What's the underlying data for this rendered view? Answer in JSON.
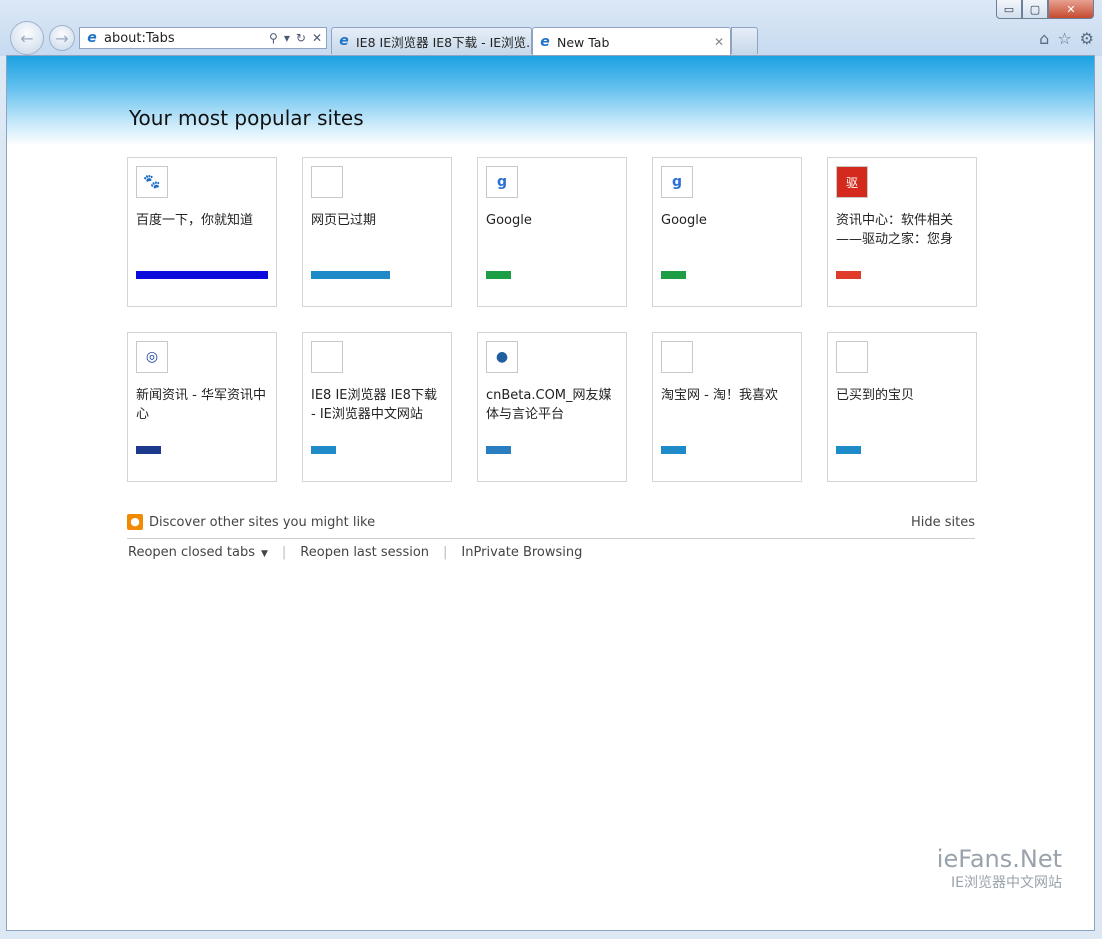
{
  "window": {
    "minimize_label": "▭",
    "maximize_label": "▢",
    "close_label": "✕"
  },
  "nav": {
    "back_icon": "←",
    "forward_icon": "→"
  },
  "address": {
    "value": "about:Tabs",
    "icon": "ie-logo-icon"
  },
  "tabs": [
    {
      "label": "IE8 IE浏览器 IE8下载 - IE浏览...",
      "active": false
    },
    {
      "label": "New Tab",
      "active": true,
      "close": "✕"
    }
  ],
  "commands": {
    "home": "⌂",
    "favorites": "☆",
    "tools": "⚙"
  },
  "page": {
    "heading": "Your most popular sites",
    "tiles": [
      {
        "title": "百度一下，你就知道",
        "icon": "baidu-paw-icon",
        "glyph": "🐾",
        "bar_color": "#0b0bdc",
        "bar_fraction": 1.0
      },
      {
        "title": "网页已过期",
        "icon": "blank-page-icon",
        "glyph": "",
        "bar_color": "#1f8ac8",
        "bar_fraction": 0.6
      },
      {
        "title": "Google",
        "icon": "google-icon",
        "glyph": "g",
        "bar_color": "#1e9e44",
        "bar_fraction": 0.19
      },
      {
        "title": "Google",
        "icon": "google-icon",
        "glyph": "g",
        "bar_color": "#1e9e44",
        "bar_fraction": 0.19
      },
      {
        "title": "资讯中心：软件相关——驱动之家：您身边...",
        "icon": "mydrivers-icon",
        "glyph": "驱",
        "bar_color": "#e03a2a",
        "bar_fraction": 0.19
      },
      {
        "title": "新闻资讯 - 华军资讯中心",
        "icon": "newhua-icon",
        "glyph": "◎",
        "bar_color": "#1c3a8c",
        "bar_fraction": 0.19
      },
      {
        "title": "IE8 IE浏览器 IE8下载 - IE浏览器中文网站",
        "icon": "blank-page-icon",
        "glyph": "",
        "bar_color": "#1f8ac8",
        "bar_fraction": 0.19
      },
      {
        "title": "cnBeta.COM_网友媒体与言论平台",
        "icon": "cnbeta-icon",
        "glyph": "●",
        "bar_color": "#2a7ec0",
        "bar_fraction": 0.19
      },
      {
        "title": "淘宝网 - 淘！我喜欢",
        "icon": "blank-page-icon",
        "glyph": "",
        "bar_color": "#1f8ac8",
        "bar_fraction": 0.19
      },
      {
        "title": "已买到的宝贝",
        "icon": "blank-page-icon",
        "glyph": "",
        "bar_color": "#1f8ac8",
        "bar_fraction": 0.19
      }
    ],
    "discover_label": "Discover other sites you might like",
    "hide_sites_label": "Hide sites",
    "reopen_closed_label": "Reopen closed tabs",
    "reopen_session_label": "Reopen last session",
    "inprivate_label": "InPrivate Browsing"
  },
  "brand": {
    "line1": "ieFans.Net",
    "line2": "IE浏览器中文网站"
  }
}
